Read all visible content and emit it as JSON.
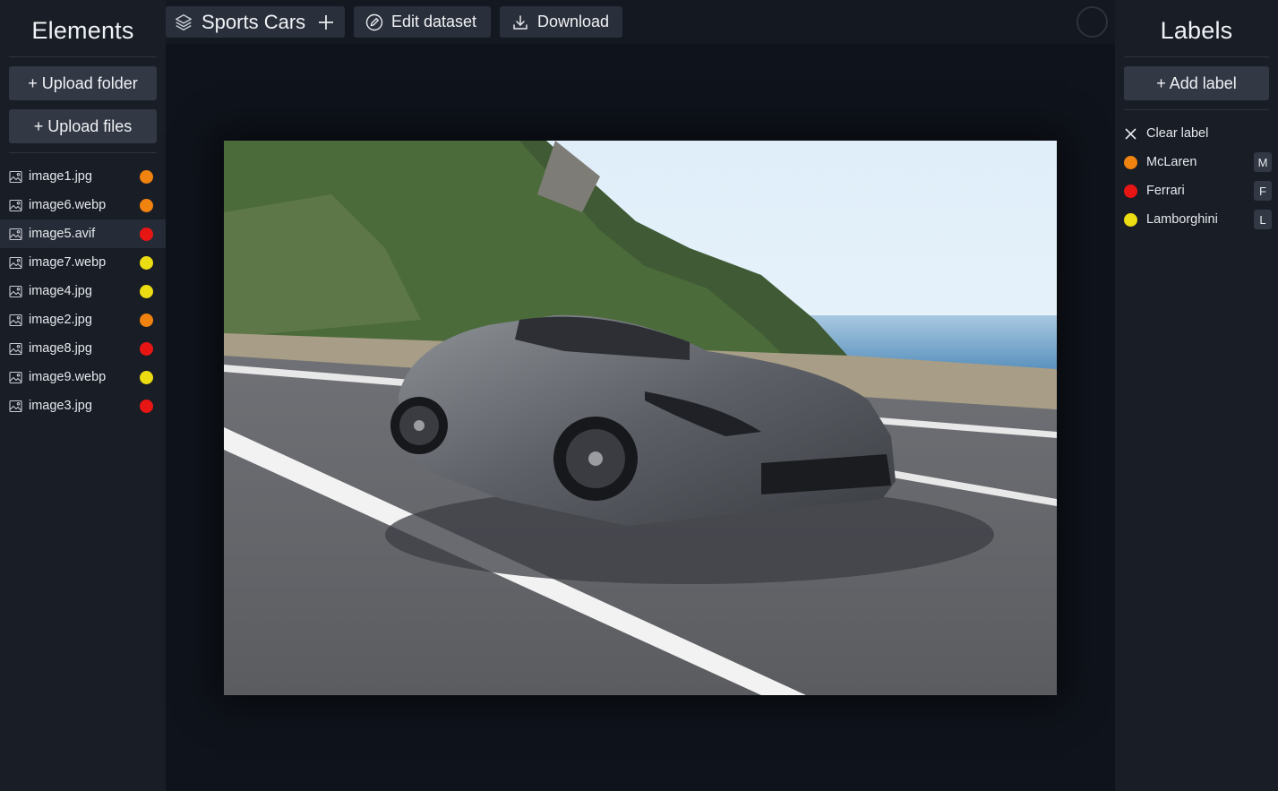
{
  "left_panel": {
    "title": "Elements",
    "upload_folder_label": "+ Upload folder",
    "upload_files_label": "+ Upload files",
    "files": [
      {
        "name": "image1.jpg",
        "label_color": "#f0820f",
        "active": false
      },
      {
        "name": "image6.webp",
        "label_color": "#f0820f",
        "active": false
      },
      {
        "name": "image5.avif",
        "label_color": "#e81515",
        "active": true
      },
      {
        "name": "image7.webp",
        "label_color": "#ecdc12",
        "active": false
      },
      {
        "name": "image4.jpg",
        "label_color": "#ecdc12",
        "active": false
      },
      {
        "name": "image2.jpg",
        "label_color": "#f0820f",
        "active": false
      },
      {
        "name": "image8.jpg",
        "label_color": "#e81515",
        "active": false
      },
      {
        "name": "image9.webp",
        "label_color": "#ecdc12",
        "active": false
      },
      {
        "name": "image3.jpg",
        "label_color": "#e81515",
        "active": false
      }
    ]
  },
  "toolbar": {
    "dataset_name": "Sports Cars",
    "edit_label": "Edit dataset",
    "download_label": "Download"
  },
  "right_panel": {
    "title": "Labels",
    "add_label": "+ Add label",
    "clear_label": "Clear label",
    "labels": [
      {
        "name": "McLaren",
        "color": "#f0820f",
        "hotkey": "M"
      },
      {
        "name": "Ferrari",
        "color": "#e81515",
        "hotkey": "F"
      },
      {
        "name": "Lamborghini",
        "color": "#ecdc12",
        "hotkey": "L"
      }
    ]
  },
  "icons": {
    "layers": "layers-icon",
    "plus": "plus-icon",
    "edit": "pencil-circle-icon",
    "download": "download-icon",
    "image": "image-icon",
    "close": "close-icon"
  }
}
